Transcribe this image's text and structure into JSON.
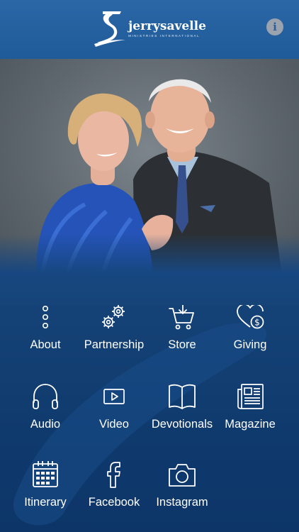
{
  "header": {
    "logo_name": "jerrysavelle",
    "logo_sub": "MINISTRIES INTERNATIONAL",
    "info_symbol": "i"
  },
  "hero": {
    "image": "Couple portrait photo"
  },
  "menu": {
    "items": [
      {
        "label": "About",
        "icon": "more-vertical-icon"
      },
      {
        "label": "Partnership",
        "icon": "gears-icon"
      },
      {
        "label": "Store",
        "icon": "cart-icon"
      },
      {
        "label": "Giving",
        "icon": "heart-dollar-icon"
      },
      {
        "label": "Audio",
        "icon": "headphones-icon"
      },
      {
        "label": "Video",
        "icon": "video-play-icon"
      },
      {
        "label": "Devotionals",
        "icon": "open-book-icon"
      },
      {
        "label": "Magazine",
        "icon": "newspaper-icon"
      },
      {
        "label": "Itinerary",
        "icon": "calendar-icon"
      },
      {
        "label": "Facebook",
        "icon": "facebook-icon"
      },
      {
        "label": "Instagram",
        "icon": "camera-icon"
      }
    ]
  },
  "colors": {
    "header": "#1f5b99",
    "menu_bg": "#123f77",
    "icon": "#ffffff"
  }
}
